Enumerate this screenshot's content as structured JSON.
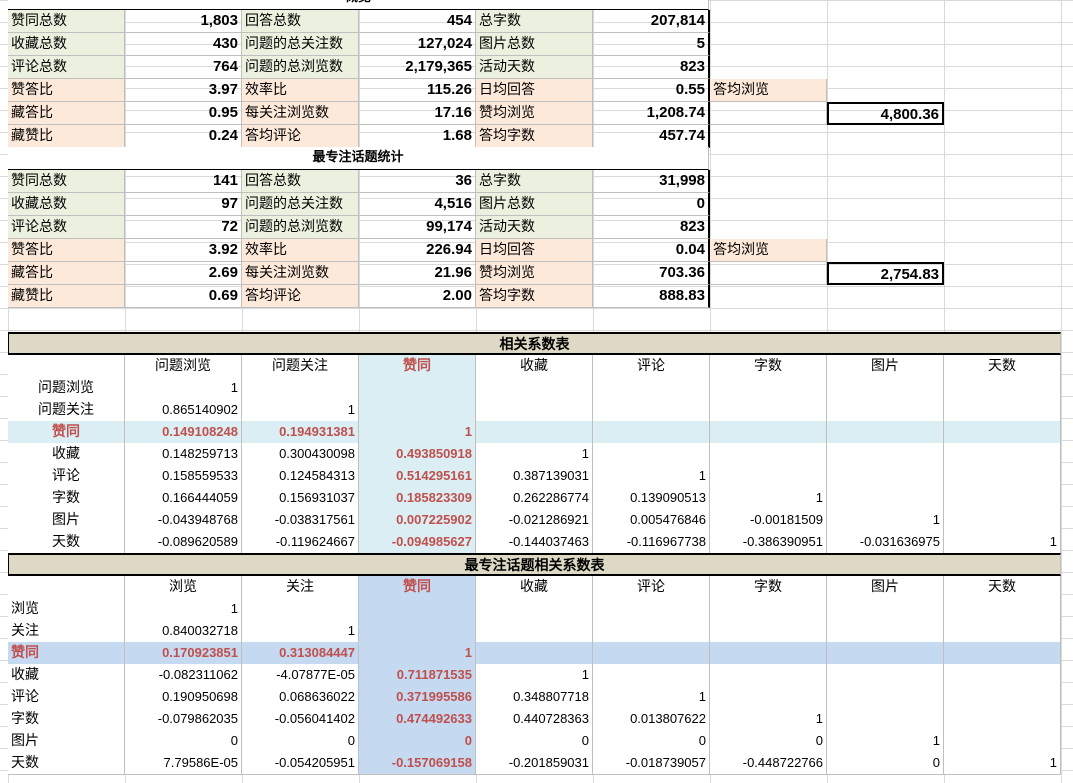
{
  "overview": {
    "title": "概览",
    "rows": [
      [
        {
          "l": "赞同总数",
          "v": "1,803",
          "t": "lab"
        },
        {
          "l": "回答总数",
          "v": "454",
          "t": "lab"
        },
        {
          "l": "总字数",
          "v": "207,814",
          "t": "lab"
        }
      ],
      [
        {
          "l": "收藏总数",
          "v": "430",
          "t": "lab"
        },
        {
          "l": "问题的总关注数",
          "v": "127,024",
          "t": "lab"
        },
        {
          "l": "图片总数",
          "v": "5",
          "t": "lab"
        }
      ],
      [
        {
          "l": "评论总数",
          "v": "764",
          "t": "lab"
        },
        {
          "l": "问题的总浏览数",
          "v": "2,179,365",
          "t": "lab"
        },
        {
          "l": "活动天数",
          "v": "823",
          "t": "lab"
        }
      ],
      [
        {
          "l": "赞答比",
          "v": "3.97",
          "t": "peach"
        },
        {
          "l": "效率比",
          "v": "115.26",
          "t": "peach"
        },
        {
          "l": "日均回答",
          "v": "0.55",
          "t": "peach"
        },
        {
          "l": "答均浏览",
          "v": "",
          "t": "peach"
        }
      ],
      [
        {
          "l": "藏答比",
          "v": "0.95",
          "t": "peach"
        },
        {
          "l": "每关注浏览数",
          "v": "17.16",
          "t": "peach"
        },
        {
          "l": "赞均浏览",
          "v": "1,208.74",
          "t": "peach"
        },
        {
          "l": "",
          "v": "4,800.36",
          "t": "none"
        }
      ],
      [
        {
          "l": "藏赞比",
          "v": "0.24",
          "t": "peach"
        },
        {
          "l": "答均评论",
          "v": "1.68",
          "t": "peach"
        },
        {
          "l": "答均字数",
          "v": "457.74",
          "t": "peach"
        }
      ]
    ]
  },
  "topic": {
    "title": "最专注话题统计",
    "rows": [
      [
        {
          "l": "赞同总数",
          "v": "141",
          "t": "lab"
        },
        {
          "l": "回答总数",
          "v": "36",
          "t": "lab"
        },
        {
          "l": "总字数",
          "v": "31,998",
          "t": "lab"
        }
      ],
      [
        {
          "l": "收藏总数",
          "v": "97",
          "t": "lab"
        },
        {
          "l": "问题的总关注数",
          "v": "4,516",
          "t": "lab"
        },
        {
          "l": "图片总数",
          "v": "0",
          "t": "lab"
        }
      ],
      [
        {
          "l": "评论总数",
          "v": "72",
          "t": "lab"
        },
        {
          "l": "问题的总浏览数",
          "v": "99,174",
          "t": "lab"
        },
        {
          "l": "活动天数",
          "v": "823",
          "t": "lab"
        }
      ],
      [
        {
          "l": "赞答比",
          "v": "3.92",
          "t": "peach"
        },
        {
          "l": "效率比",
          "v": "226.94",
          "t": "peach"
        },
        {
          "l": "日均回答",
          "v": "0.04",
          "t": "peach"
        },
        {
          "l": "答均浏览",
          "v": "",
          "t": "peach"
        }
      ],
      [
        {
          "l": "藏答比",
          "v": "2.69",
          "t": "peach"
        },
        {
          "l": "每关注浏览数",
          "v": "21.96",
          "t": "peach"
        },
        {
          "l": "赞均浏览",
          "v": "703.36",
          "t": "peach"
        },
        {
          "l": "",
          "v": "2,754.83",
          "t": "none"
        }
      ],
      [
        {
          "l": "藏赞比",
          "v": "0.69",
          "t": "peach"
        },
        {
          "l": "答均评论",
          "v": "2.00",
          "t": "peach"
        },
        {
          "l": "答均字数",
          "v": "888.83",
          "t": "peach"
        }
      ]
    ]
  },
  "corr1": {
    "title": "相关系数表",
    "cols": [
      "问题浏览",
      "问题关注",
      "赞同",
      "收藏",
      "评论",
      "字数",
      "图片",
      "天数"
    ],
    "rows": [
      {
        "name": "问题浏览",
        "vals": [
          "1",
          "",
          "",
          "",
          "",
          "",
          "",
          ""
        ]
      },
      {
        "name": "问题关注",
        "vals": [
          "0.865140902",
          "1",
          "",
          "",
          "",
          "",
          "",
          ""
        ]
      },
      {
        "name": "赞同",
        "vals": [
          "0.149108248",
          "0.194931381",
          "1",
          "",
          "",
          "",
          "",
          ""
        ]
      },
      {
        "name": "收藏",
        "vals": [
          "0.148259713",
          "0.300430098",
          "0.493850918",
          "1",
          "",
          "",
          "",
          ""
        ]
      },
      {
        "name": "评论",
        "vals": [
          "0.158559533",
          "0.124584313",
          "0.514295161",
          "0.387139031",
          "1",
          "",
          "",
          ""
        ]
      },
      {
        "name": "字数",
        "vals": [
          "0.166444059",
          "0.156931037",
          "0.185823309",
          "0.262286774",
          "0.139090513",
          "1",
          "",
          ""
        ]
      },
      {
        "name": "图片",
        "vals": [
          "-0.043948768",
          "-0.038317561",
          "0.007225902",
          "-0.021286921",
          "0.005476846",
          "-0.00181509",
          "1",
          ""
        ]
      },
      {
        "name": "天数",
        "vals": [
          "-0.089620589",
          "-0.119624667",
          "-0.094985627",
          "-0.144037463",
          "-0.116967738",
          "-0.386390951",
          "-0.031636975",
          "1"
        ]
      }
    ]
  },
  "corr2": {
    "title": "最专注话题相关系数表",
    "cols": [
      "浏览",
      "关注",
      "赞同",
      "收藏",
      "评论",
      "字数",
      "图片",
      "天数"
    ],
    "rows": [
      {
        "name": "浏览",
        "vals": [
          "1",
          "",
          "",
          "",
          "",
          "",
          "",
          ""
        ]
      },
      {
        "name": "关注",
        "vals": [
          "0.840032718",
          "1",
          "",
          "",
          "",
          "",
          "",
          ""
        ]
      },
      {
        "name": "赞同",
        "vals": [
          "0.170923851",
          "0.313084447",
          "1",
          "",
          "",
          "",
          "",
          ""
        ]
      },
      {
        "name": "收藏",
        "vals": [
          "-0.082311062",
          "-4.07877E-05",
          "0.711871535",
          "1",
          "",
          "",
          "",
          ""
        ]
      },
      {
        "name": "评论",
        "vals": [
          "0.190950698",
          "0.068636022",
          "0.371995586",
          "0.348807718",
          "1",
          "",
          "",
          ""
        ]
      },
      {
        "name": "字数",
        "vals": [
          "-0.079862035",
          "-0.056041402",
          "0.474492633",
          "0.440728363",
          "0.013807622",
          "1",
          "",
          ""
        ]
      },
      {
        "name": "图片",
        "vals": [
          "0",
          "0",
          "0",
          "0",
          "0",
          "0",
          "1",
          ""
        ]
      },
      {
        "name": "天数",
        "vals": [
          "7.79586E-05",
          "-0.054205951",
          "-0.157069158",
          "-0.201859031",
          "-0.018739057",
          "-0.448722766",
          "0",
          "1"
        ]
      }
    ]
  }
}
